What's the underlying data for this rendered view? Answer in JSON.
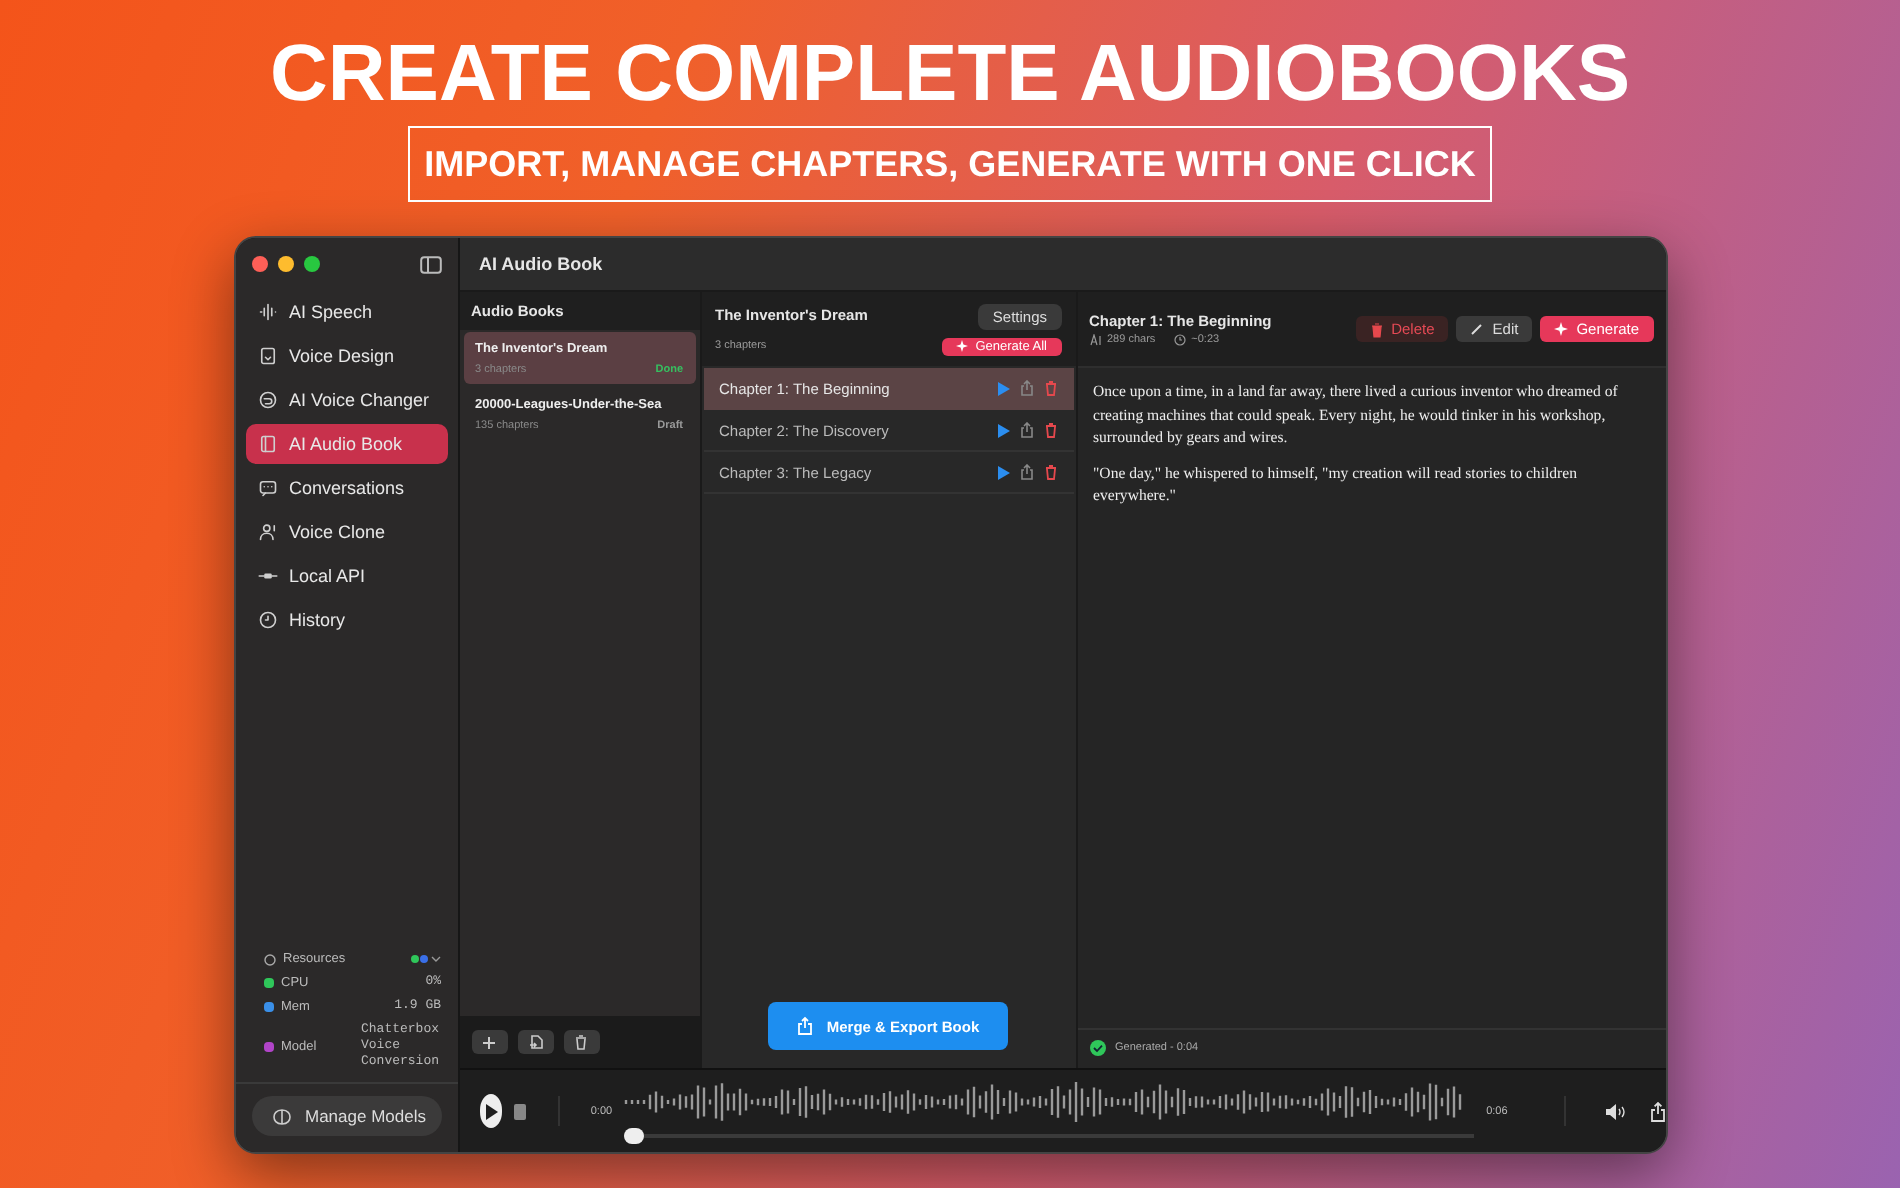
{
  "headline": "CREATE COMPLETE AUDIOBOOKS",
  "subheadline": "IMPORT, MANAGE CHAPTERS, GENERATE WITH ONE CLICK",
  "window": {
    "title": "AI Audio Book"
  },
  "sidebar": {
    "items": [
      {
        "label": "AI Speech",
        "selected": false
      },
      {
        "label": "Voice Design",
        "selected": false
      },
      {
        "label": "AI Voice Changer",
        "selected": false
      },
      {
        "label": "AI Audio Book",
        "selected": true
      },
      {
        "label": "Conversations",
        "selected": false
      },
      {
        "label": "Voice Clone",
        "selected": false
      },
      {
        "label": "Local API",
        "selected": false
      },
      {
        "label": "History",
        "selected": false
      }
    ],
    "resources": {
      "label": "Resources",
      "stats": [
        {
          "label": "CPU",
          "value": "0%",
          "color": "#2fc65a"
        },
        {
          "label": "Mem",
          "value": "1.9 GB",
          "color": "#3a8fe8"
        },
        {
          "label": "Model",
          "value": "Chatterbox Voice Conversion",
          "color": "#b144c8"
        }
      ]
    },
    "manage_models": "Manage Models"
  },
  "books": {
    "heading": "Audio Books",
    "items": [
      {
        "title": "The Inventor's Dream",
        "chapters": "3 chapters",
        "status": "Done",
        "color": "#36c060",
        "selected": true
      },
      {
        "title": "20000-Leagues-Under-the-Sea",
        "chapters": "135 chapters",
        "status": "Draft",
        "color": "#9a9a9a",
        "selected": false
      }
    ]
  },
  "chapters": {
    "title": "The Inventor's Dream",
    "count": "3 chapters",
    "settings": "Settings",
    "generate_all": "Generate All",
    "items": [
      {
        "title": "Chapter 1: The Beginning",
        "selected": true
      },
      {
        "title": "Chapter 2: The Discovery",
        "selected": false
      },
      {
        "title": "Chapter 3: The Legacy",
        "selected": false
      }
    ],
    "merge_button": "Merge & Export Book"
  },
  "detail": {
    "title": "Chapter 1: The Beginning",
    "chars": "289 chars",
    "duration": "~0:23",
    "delete": "Delete",
    "edit": "Edit",
    "generate": "Generate",
    "paragraphs": [
      "Once upon a time, in a land far away, there lived a curious inventor who dreamed of creating machines that could speak. Every night, he would tinker in his workshop, surrounded by gears and wires.",
      "\"One day,\" he whispered to himself, \"my creation will read stories to children everywhere.\""
    ],
    "status": "Generated - 0:04"
  },
  "player": {
    "current": "0:00",
    "total": "0:06",
    "level": 0
  }
}
